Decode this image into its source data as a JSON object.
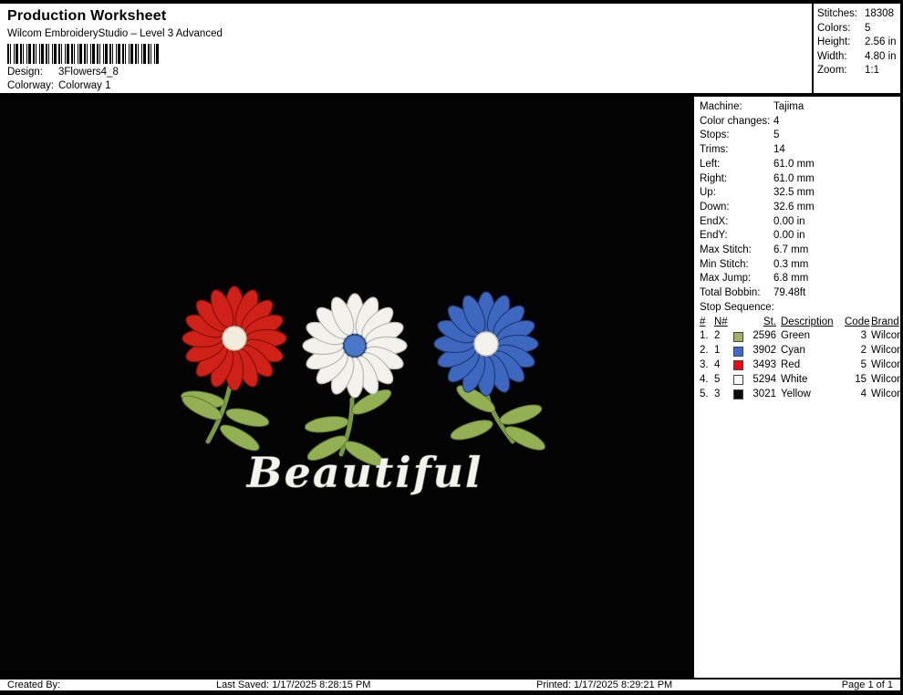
{
  "header": {
    "title": "Production Worksheet",
    "subtitle": "Wilcom EmbroideryStudio – Level 3 Advanced",
    "design_label": "Design:",
    "design_value": "3Flowers4_8",
    "colorway_label": "Colorway:",
    "colorway_value": "Colorway 1",
    "stats": [
      {
        "label": "Stitches:",
        "value": "18308"
      },
      {
        "label": "Colors:",
        "value": "5"
      },
      {
        "label": "Height:",
        "value": "2.56 in"
      },
      {
        "label": "Width:",
        "value": "4.80 in"
      },
      {
        "label": "Zoom:",
        "value": "1:1"
      }
    ]
  },
  "machine_info": [
    {
      "label": "Machine:",
      "value": "Tajima"
    },
    {
      "label": "Color changes:",
      "value": "4"
    },
    {
      "label": "Stops:",
      "value": "5"
    },
    {
      "label": "Trims:",
      "value": "14"
    },
    {
      "label": "Left:",
      "value": "61.0 mm"
    },
    {
      "label": "Right:",
      "value": "61.0 mm"
    },
    {
      "label": "Up:",
      "value": "32.5 mm"
    },
    {
      "label": "Down:",
      "value": "32.6 mm"
    },
    {
      "label": "EndX:",
      "value": "0.00 in"
    },
    {
      "label": "EndY:",
      "value": "0.00 in"
    },
    {
      "label": "Max Stitch:",
      "value": "6.7 mm"
    },
    {
      "label": "Min Stitch:",
      "value": "0.3 mm"
    },
    {
      "label": "Max Jump:",
      "value": "6.8 mm"
    },
    {
      "label": "Total Bobbin:",
      "value": "79.48ft"
    }
  ],
  "stop_sequence": {
    "title": "Stop Sequence:",
    "headers": [
      "#",
      "N#",
      "St.",
      "Description",
      "Code",
      "Brand"
    ],
    "rows": [
      {
        "num": "1.",
        "n": "2",
        "swatch": "#a3b05c",
        "st": "2596",
        "description": "Green",
        "code": "3",
        "brand": "Wilcom"
      },
      {
        "num": "2.",
        "n": "1",
        "swatch": "#3a6bd8",
        "st": "3902",
        "description": "Cyan",
        "code": "2",
        "brand": "Wilcom"
      },
      {
        "num": "3.",
        "n": "4",
        "swatch": "#ea0a10",
        "st": "3493",
        "description": "Red",
        "code": "5",
        "brand": "Wilcom"
      },
      {
        "num": "4.",
        "n": "5",
        "swatch": "#ffffff",
        "st": "5294",
        "description": "White",
        "code": "15",
        "brand": "Wilcom"
      },
      {
        "num": "5.",
        "n": "3",
        "swatch": "#0a0a0a",
        "st": "3021",
        "description": "Yellow",
        "code": "4",
        "brand": "Wilcom"
      }
    ]
  },
  "design": {
    "caption": "Beautiful"
  },
  "footer": {
    "created_by": "Created By:",
    "last_saved": "Last Saved: 1/17/2025 8:28:15 PM",
    "printed": "Printed: 1/17/2025 8:29:21 PM",
    "page": "Page 1 of 1"
  }
}
